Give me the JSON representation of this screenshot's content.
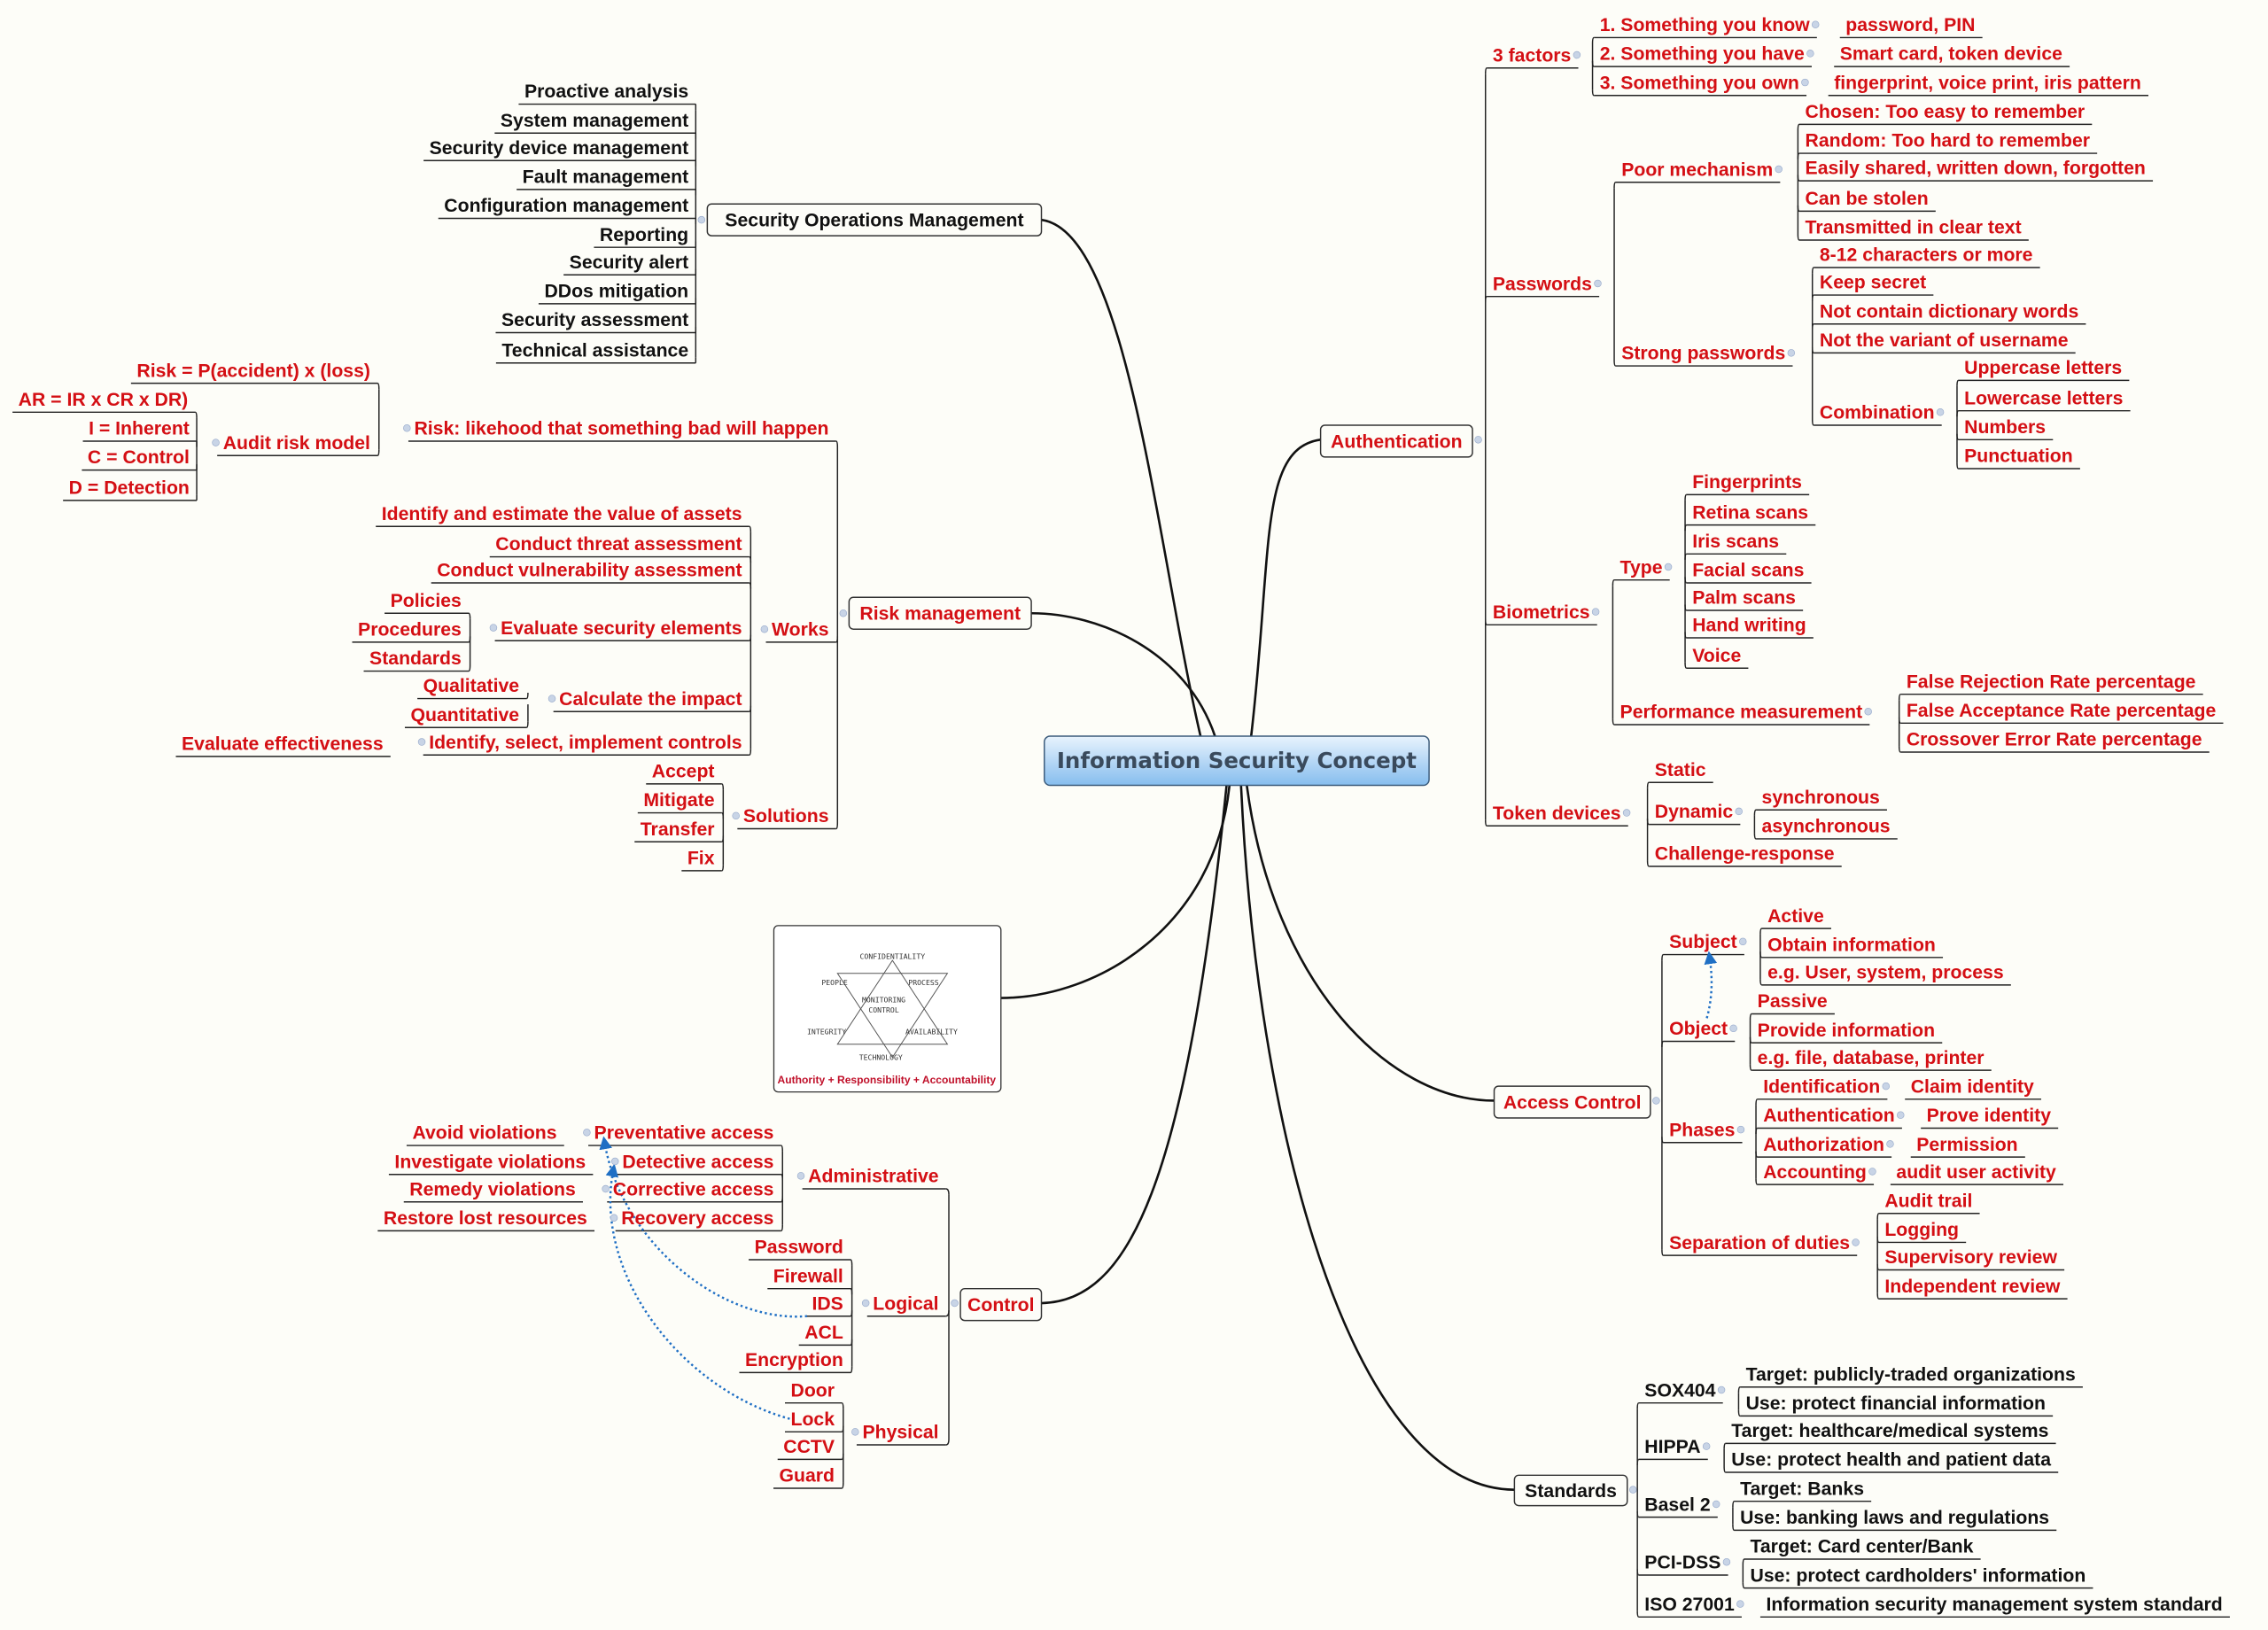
{
  "center": {
    "label": "Information Security Concept"
  },
  "colors": {
    "branch_text": "#d40f14",
    "ops_text": "#111111",
    "center_fill_top": "#e3f0fc",
    "center_fill_bottom": "#8cc0ef",
    "relation_line": "#1f6fc4",
    "background": "#fdfdf8"
  },
  "security_operations": {
    "label": "Security Operations Management",
    "items": [
      "Proactive analysis",
      "System management",
      "Security device management",
      "Fault management",
      "Configuration management",
      "Reporting",
      "Security alert",
      "DDos mitigation",
      "Security assessment",
      "Technical assistance"
    ]
  },
  "risk": {
    "definition": "Risk: likehood that something bad will happen",
    "audit_model": "Audit risk model",
    "formula": "Risk = P(accident) x (loss)",
    "audit_formula": "AR = IR x CR x DR)",
    "audit_terms": [
      "I = Inherent",
      "C = Control",
      "D = Detection"
    ]
  },
  "risk_management": {
    "label": "Risk management",
    "works": "Works",
    "works_items": [
      "Identify and estimate the value of assets",
      "Conduct threat assessment",
      "Conduct vulnerability assessment",
      "Evaluate security elements",
      "Calculate the impact",
      "Identify, select, implement controls"
    ],
    "security_elements": [
      "Policies",
      "Procedures",
      "Standards"
    ],
    "impact": [
      "Qualitative",
      "Quantitative"
    ],
    "controls_child": "Evaluate effectiveness",
    "solutions": "Solutions",
    "solutions_items": [
      "Accept",
      "Mitigate",
      "Transfer",
      "Fix"
    ]
  },
  "diagram_image": {
    "labels": {
      "top": "CONFIDENTIALITY",
      "people": "PEOPLE",
      "process": "PROCESS",
      "center1": "MONITORING",
      "center2": "CONTROL",
      "integrity": "INTEGRITY",
      "availability": "AVAILABILITY",
      "bottom": "TECHNOLOGY"
    },
    "caption": "Authority + Responsibility + Accountability"
  },
  "control": {
    "label": "Control",
    "administrative": "Administrative",
    "admin_items": [
      {
        "label": "Preventative access",
        "child": "Avoid violations"
      },
      {
        "label": "Detective access",
        "child": "Investigate violations"
      },
      {
        "label": "Corrective access",
        "child": "Remedy violations"
      },
      {
        "label": "Recovery access",
        "child": "Restore lost resources"
      }
    ],
    "logical": "Logical",
    "logical_items": [
      "Password",
      "Firewall",
      "IDS",
      "ACL",
      "Encryption"
    ],
    "physical": "Physical",
    "physical_items": [
      "Door",
      "Lock",
      "CCTV",
      "Guard"
    ]
  },
  "authentication": {
    "label": "Authentication",
    "factors": "3 factors",
    "factor_items": [
      {
        "label": "1. Something you know",
        "child": "password, PIN"
      },
      {
        "label": "2. Something you have",
        "child": "Smart card, token device"
      },
      {
        "label": "3. Something you own",
        "child": "fingerprint, voice print, iris pattern"
      }
    ],
    "passwords": "Passwords",
    "poor": "Poor mechanism",
    "poor_items": [
      "Chosen: Too easy to remember",
      "Random: Too hard to remember",
      "Easily shared, written down, forgotten",
      "Can be stolen",
      "Transmitted in clear text"
    ],
    "strong": "Strong passwords",
    "strong_items": [
      "8-12 characters or more",
      "Keep secret",
      "Not contain dictionary words",
      "Not the variant of username",
      "Combination"
    ],
    "combination_items": [
      "Uppercase letters",
      "Lowercase letters",
      "Numbers",
      "Punctuation"
    ],
    "biometrics": "Biometrics",
    "type": "Type",
    "type_items": [
      "Fingerprints",
      "Retina scans",
      "Iris scans",
      "Facial scans",
      "Palm scans",
      "Hand writing",
      "Voice"
    ],
    "performance": "Performance measurement",
    "performance_items": [
      "False Rejection Rate percentage",
      "False Acceptance Rate percentage",
      "Crossover Error Rate percentage"
    ],
    "tokens": "Token devices",
    "token_items": [
      "Static",
      "Dynamic",
      "Challenge-response"
    ],
    "dynamic_items": [
      "synchronous",
      "asynchronous"
    ]
  },
  "access_control": {
    "label": "Access Control",
    "subject": "Subject",
    "subject_items": [
      "Active",
      "Obtain information",
      "e.g. User, system, process"
    ],
    "object": "Object",
    "object_items": [
      "Passive",
      "Provide information",
      "e.g. file, database, printer"
    ],
    "phases": "Phases",
    "phase_items": [
      {
        "label": "Identification",
        "child": "Claim identity"
      },
      {
        "label": "Authentication",
        "child": "Prove identity"
      },
      {
        "label": "Authorization",
        "child": "Permission"
      },
      {
        "label": "Accounting",
        "child": "audit user activity"
      }
    ],
    "separation": "Separation of duties",
    "separation_items": [
      "Audit trail",
      "Logging",
      "Supervisory review",
      "Independent review"
    ]
  },
  "standards": {
    "label": "Standards",
    "items": [
      {
        "label": "SOX404",
        "children": [
          "Target: publicly-traded organizations",
          "Use: protect financial information"
        ]
      },
      {
        "label": "HIPPA",
        "children": [
          "Target: healthcare/medical systems",
          "Use: protect health and patient data"
        ]
      },
      {
        "label": "Basel 2",
        "children": [
          "Target: Banks",
          "Use: banking laws and regulations"
        ]
      },
      {
        "label": "PCI-DSS",
        "children": [
          "Target: Card center/Bank",
          "Use: protect cardholders' information"
        ]
      },
      {
        "label": "ISO 27001",
        "children": [
          "Information security management system standard"
        ]
      }
    ]
  }
}
